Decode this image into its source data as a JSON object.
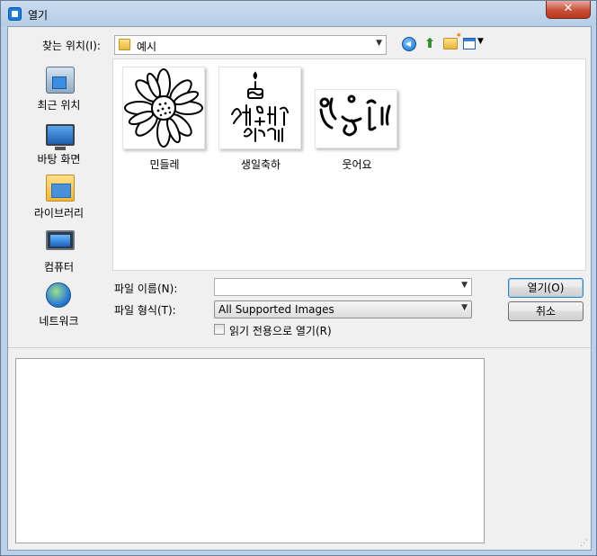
{
  "window": {
    "title": "열기",
    "close_symbol": "✕"
  },
  "lookin": {
    "label": "찾는 위치(I):",
    "value": "예시"
  },
  "places": [
    {
      "label": "최근 위치",
      "icon": "recent-places-icon"
    },
    {
      "label": "바탕 화면",
      "icon": "desktop-icon"
    },
    {
      "label": "라이브러리",
      "icon": "libraries-icon"
    },
    {
      "label": "컴퓨터",
      "icon": "computer-icon"
    },
    {
      "label": "네트워크",
      "icon": "network-icon"
    }
  ],
  "files": [
    {
      "name": "민들레"
    },
    {
      "name": "생일축하"
    },
    {
      "name": "웃어요"
    }
  ],
  "filename": {
    "label": "파일 이름(N):",
    "value": ""
  },
  "filetype": {
    "label": "파일 형식(T):",
    "value": "All Supported Images"
  },
  "readonly": {
    "label": "읽기 전용으로 열기(R)",
    "checked": false
  },
  "buttons": {
    "open": "열기(O)",
    "cancel": "취소"
  }
}
